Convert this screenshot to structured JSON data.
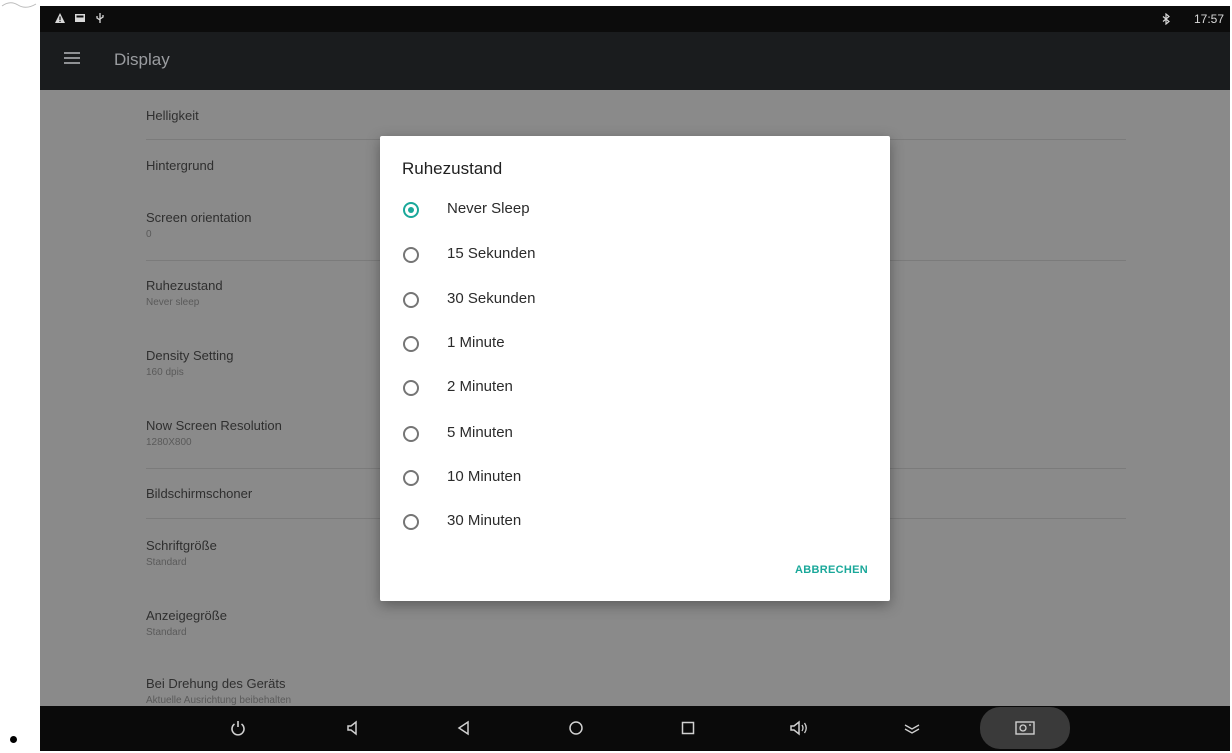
{
  "status_bar": {
    "time": "17:57",
    "icons_left": [
      "warning-icon",
      "image-icon",
      "usb-icon"
    ],
    "icons_right": [
      "bluetooth-icon"
    ]
  },
  "toolbar": {
    "title": "Display",
    "menu_icon": "hamburger-menu-icon"
  },
  "settings": [
    {
      "title": "Helligkeit",
      "summary": ""
    },
    {
      "title": "Hintergrund",
      "summary": ""
    },
    {
      "title": "Screen orientation",
      "summary": "0"
    },
    {
      "title": "Ruhezustand",
      "summary": "Never sleep"
    },
    {
      "title": "Density Setting",
      "summary": "160 dpis"
    },
    {
      "title": "Now Screen Resolution",
      "summary": "1280X800"
    },
    {
      "title": "Bildschirmschoner",
      "summary": ""
    },
    {
      "title": "Schriftgröße",
      "summary": "Standard"
    },
    {
      "title": "Anzeigegröße",
      "summary": "Standard"
    },
    {
      "title": "Bei Drehung des Geräts",
      "summary": "Aktuelle Ausrichtung beibehalten"
    }
  ],
  "dialog": {
    "title": "Ruhezustand",
    "selected_index": 0,
    "options": [
      "Never Sleep",
      "15 Sekunden",
      "30 Sekunden",
      "1 Minute",
      "2 Minuten",
      "5 Minuten",
      "10 Minuten",
      "30 Minuten"
    ],
    "cancel_label": "ABBRECHEN",
    "accent_color": "#1aa89a"
  },
  "nav_bar": {
    "buttons": [
      "power-icon",
      "volume-down-icon",
      "back-icon",
      "home-icon",
      "recents-icon",
      "volume-up-icon",
      "collapse-icon",
      "screenshot-icon"
    ]
  }
}
